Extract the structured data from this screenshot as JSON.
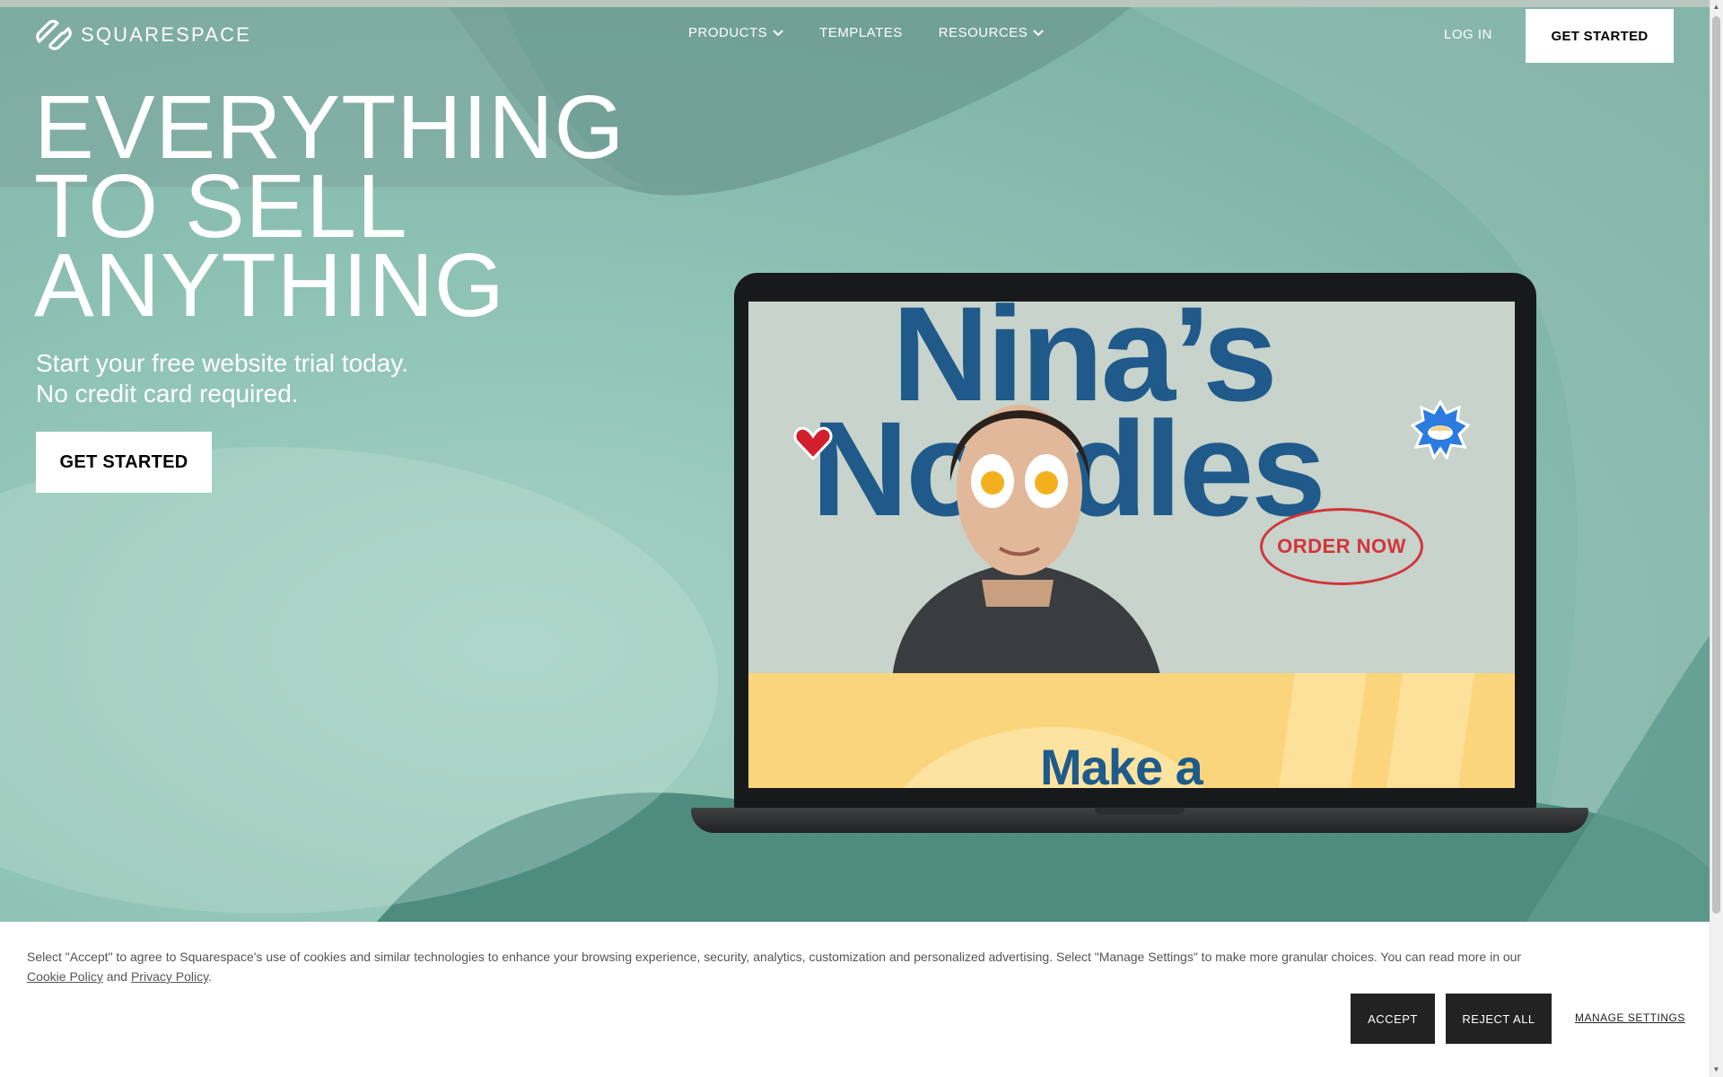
{
  "header": {
    "logo_text": "SQUARESPACE",
    "nav": [
      {
        "label": "PRODUCTS",
        "has_dropdown": true
      },
      {
        "label": "TEMPLATES",
        "has_dropdown": false
      },
      {
        "label": "RESOURCES",
        "has_dropdown": true
      }
    ],
    "login_label": "LOG IN",
    "cta_label": "GET STARTED"
  },
  "hero": {
    "headline": [
      "EVERYTHING",
      "TO SELL",
      "ANYTHING"
    ],
    "subline": [
      "Start your free website trial today.",
      "No credit card required."
    ],
    "cta_label": "GET STARTED"
  },
  "laptop_screen": {
    "brand_line_1": "Nina’s",
    "brand_line_2": "Noodles",
    "order_label": "ORDER NOW",
    "bottom_text": "Make a"
  },
  "cookie_banner": {
    "text_before": "Select \"Accept\" to agree to Squarespace's use of cookies and similar technologies to enhance your browsing experience, security, analytics, customization and personalized advertising. Select \"Manage Settings\" to make more granular choices. You can read more in our",
    "cookie_policy_link": "Cookie Policy",
    "and_text": "and",
    "privacy_policy_link": "Privacy Policy",
    "period": ".",
    "accept_label": "ACCEPT",
    "reject_label": "REJECT ALL",
    "manage_label": "MANAGE SETTINGS"
  },
  "colors": {
    "hero_teal": "#74aa9f",
    "brand_blue": "#1f5a8a",
    "order_red": "#d3343a",
    "banner_yellow": "#fbd57b"
  },
  "icons": [
    "squarespace-logo-icon",
    "chevron-down-icon",
    "heart-sticker-icon",
    "noodle-bowl-sticker-icon"
  ]
}
